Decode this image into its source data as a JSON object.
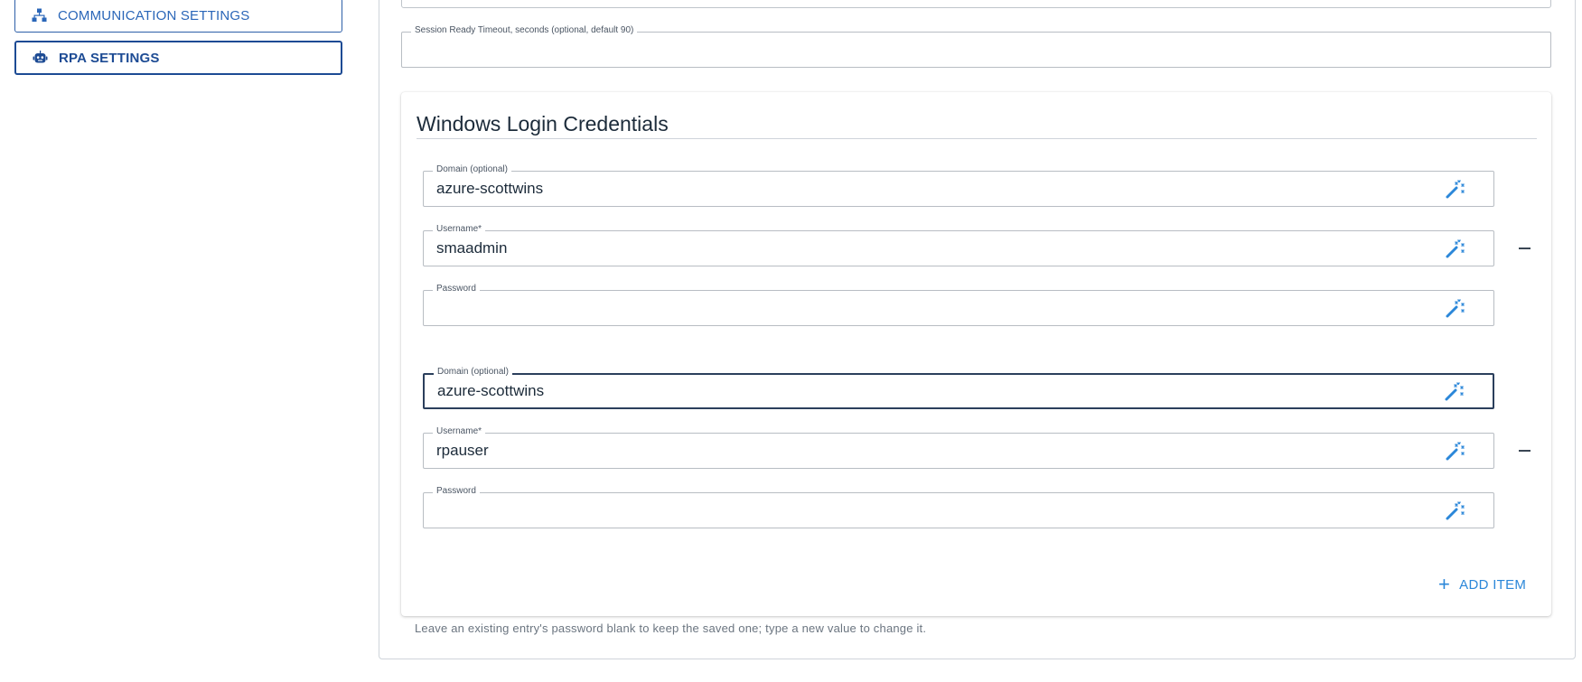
{
  "sidebar": {
    "items": [
      {
        "label": "COMMUNICATION SETTINGS",
        "icon": "sitemap-icon"
      },
      {
        "label": "RPA SETTINGS",
        "icon": "robot-icon"
      }
    ]
  },
  "session_timeout": {
    "label": "Session Ready Timeout, seconds (optional, default 90)",
    "value": ""
  },
  "credentials": {
    "title": "Windows Login Credentials",
    "entries": [
      {
        "domain_label": "Domain (optional)",
        "domain_value": "azure-scottwins",
        "username_label": "Username*",
        "username_value": "smaadmin",
        "password_label": "Password",
        "password_value": ""
      },
      {
        "domain_label": "Domain (optional)",
        "domain_value": "azure-scottwins",
        "username_label": "Username*",
        "username_value": "rpauser",
        "password_label": "Password",
        "password_value": ""
      }
    ],
    "add_item_label": "ADD ITEM"
  },
  "hint": "Leave an existing entry's password blank to keep the saved one; type a new value to change it.",
  "colors": {
    "primary": "#2a66b8",
    "primary_dark": "#1d4b94",
    "accent": "#2b87d9",
    "text": "#1c2b3a",
    "muted": "#6b7580"
  }
}
